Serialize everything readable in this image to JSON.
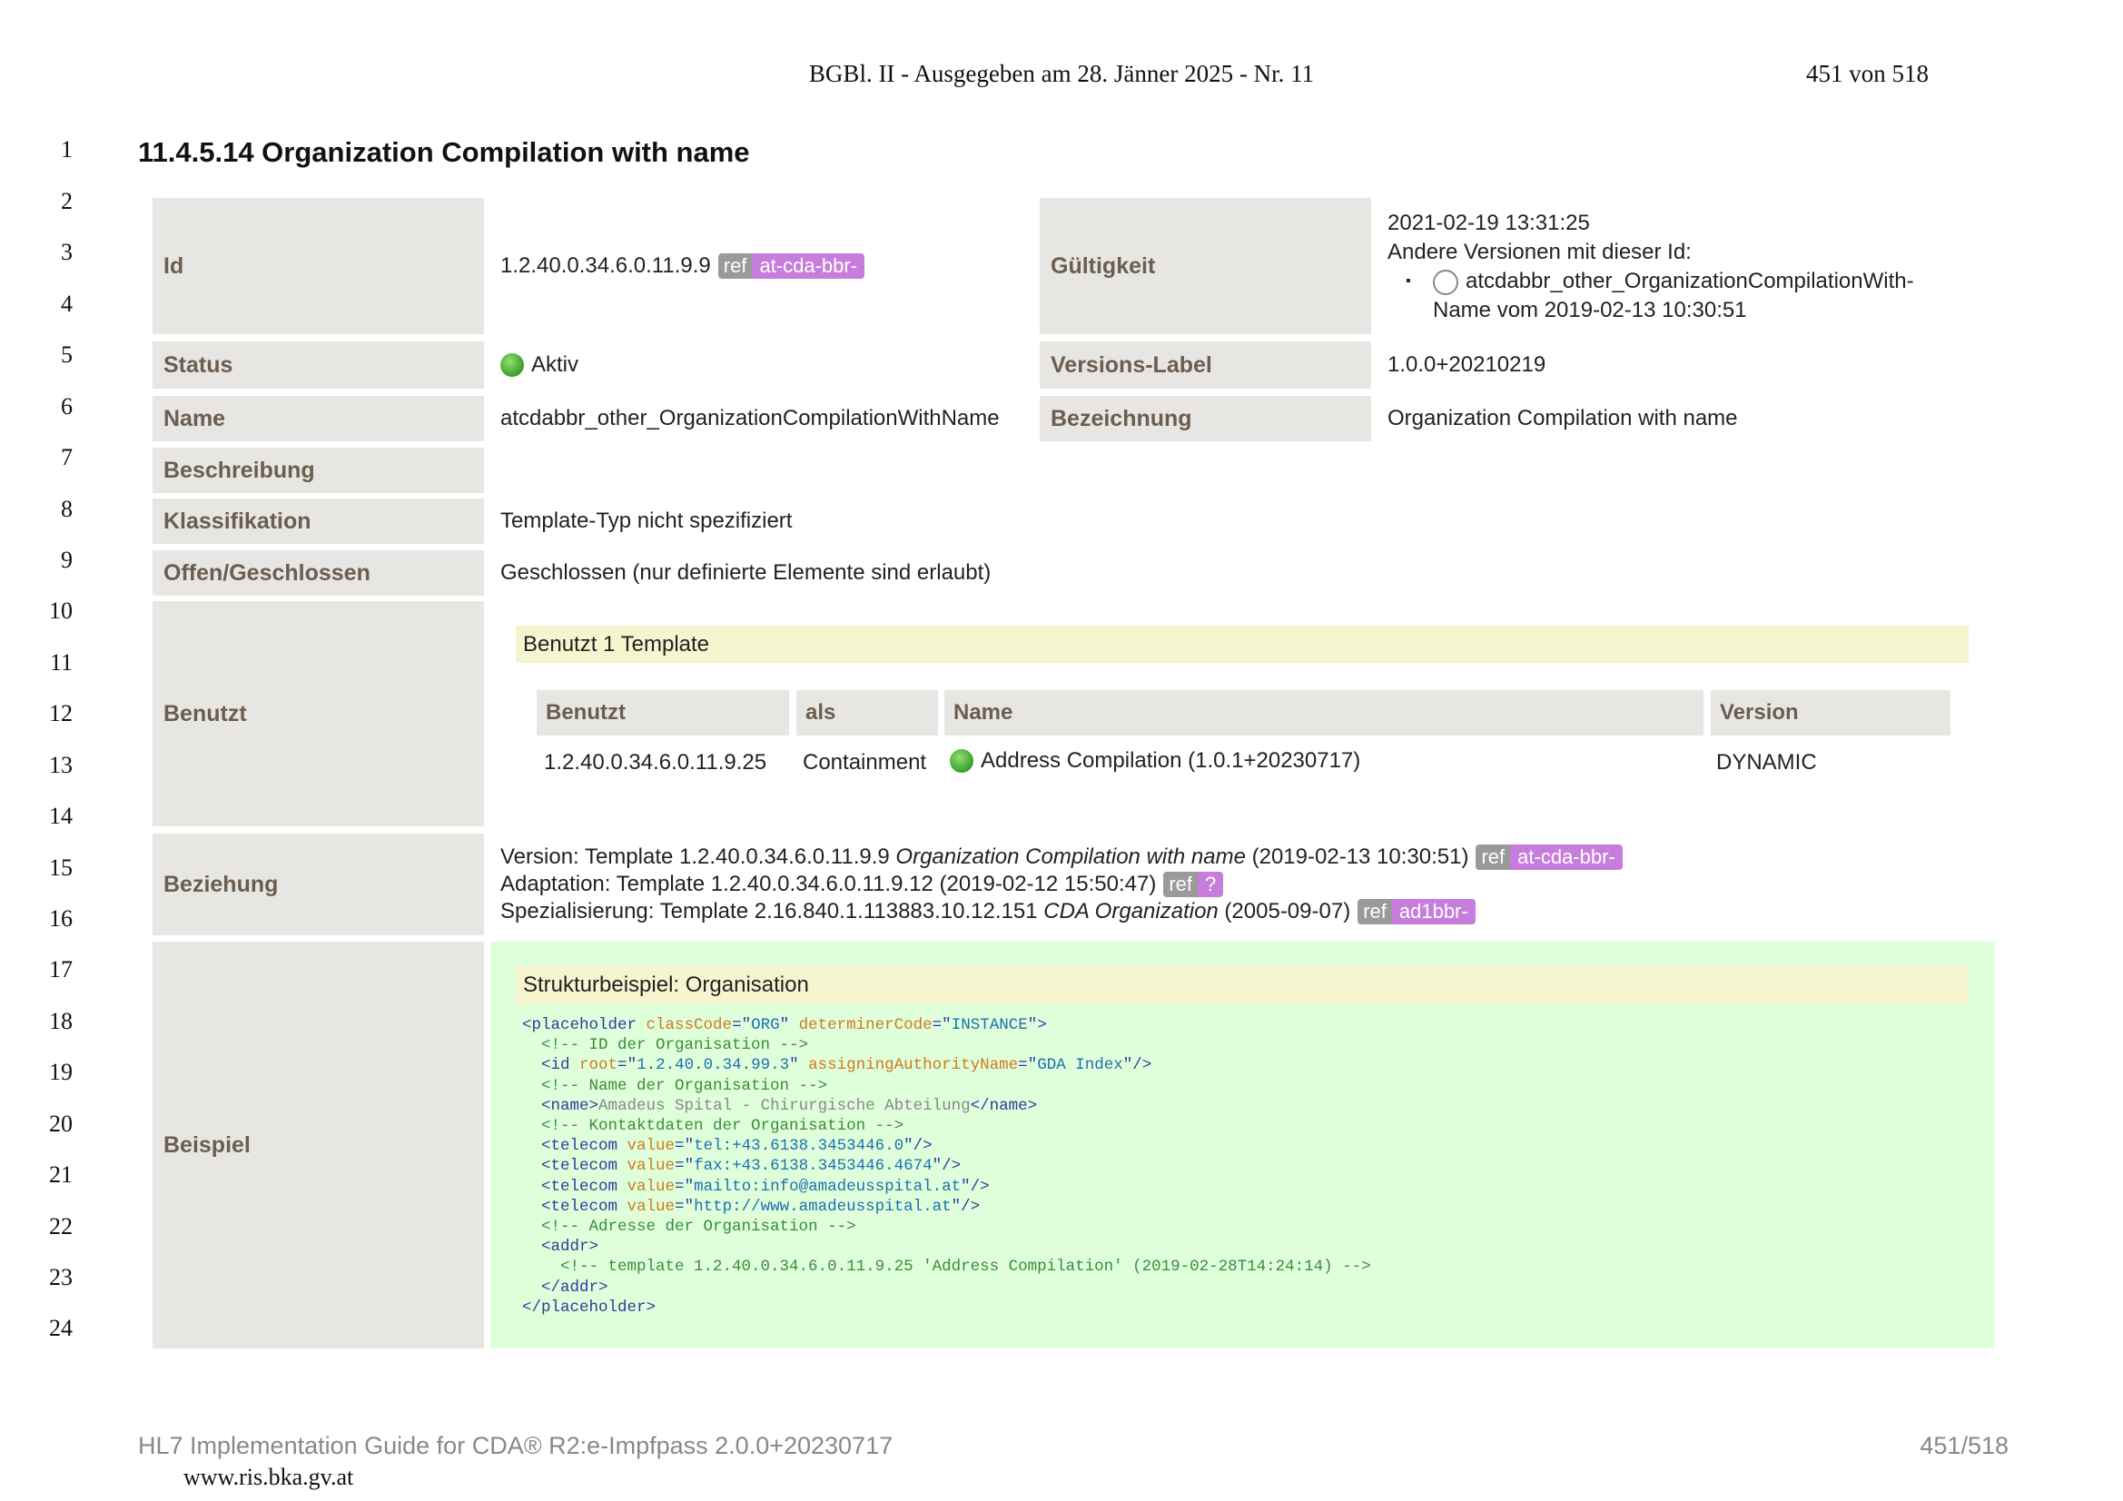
{
  "header": {
    "gazette": "BGBl. II - Ausgegeben am 28. Jänner 2025 - Nr. 11",
    "page": "451 von 518"
  },
  "line_numbers": [
    "1",
    "2",
    "3",
    "4",
    "5",
    "6",
    "7",
    "8",
    "9",
    "10",
    "11",
    "12",
    "13",
    "14",
    "15",
    "16",
    "17",
    "18",
    "19",
    "20",
    "21",
    "22",
    "23",
    "24"
  ],
  "section_title": "11.4.5.14 Organization Compilation with name",
  "table": {
    "id_label": "Id",
    "id_value": "1.2.40.0.34.6.0.11.9.9",
    "id_ref": {
      "tag": "ref",
      "prefix": "at-cda-bbr-"
    },
    "validity_label": "Gültigkeit",
    "validity_date": "2021-02-19 13:31:25",
    "validity_other_versions": "Andere Versionen mit dieser Id:",
    "validity_bullet": "▪",
    "validity_version_line1": "atcdabbr_other_OrganizationCompilationWith-",
    "validity_version_line2": "Name vom 2019-02-13 10:30:51",
    "status_label": "Status",
    "status_value": "Aktiv",
    "versions_label": "Versions-Label",
    "versions_value": "1.0.0+20210219",
    "name_label": "Name",
    "name_value": "atcdabbr_other_OrganizationCompilationWithName",
    "bezeichnung_label": "Bezeichnung",
    "bezeichnung_value": "Organization Compilation with name",
    "beschreibung_label": "Beschreibung",
    "klassifikation_label": "Klassifikation",
    "klassifikation_value": "Template-Typ nicht spezifiziert",
    "offen_label": "Offen/Geschlossen",
    "offen_value": "Geschlossen (nur definierte Elemente sind erlaubt)",
    "benutzt_label": "Benutzt",
    "benutzt_bar": "Benutzt 1 Template",
    "benutzt_headers": [
      "Benutzt",
      "als",
      "Name",
      "Version"
    ],
    "benutzt_row": {
      "id": "1.2.40.0.34.6.0.11.9.25",
      "als": "Containment",
      "name": "Address Compilation (1.0.1+20230717)",
      "version": "DYNAMIC"
    },
    "beziehung_label": "Beziehung",
    "beziehung": {
      "l1_pre": "Version: Template 1.2.40.0.34.6.0.11.9.9 ",
      "l1_italic": "Organization Compilation with name",
      "l1_post": " (2019-02-13 10:30:51)",
      "l1_ref": "at-cda-bbr-",
      "l2_text": "Adaptation: Template 1.2.40.0.34.6.0.11.9.12 (2019-02-12 15:50:47)",
      "l2_ref": "?",
      "l3_pre": "Spezialisierung: Template 2.16.840.1.113883.10.12.151 ",
      "l3_italic": "CDA Organization",
      "l3_post": " (2005-09-07)",
      "l3_ref": "ad1bbr-",
      "ref_tag": "ref"
    },
    "beispiel_label": "Beispiel",
    "beispiel_bar": "Strukturbeispiel: Organisation"
  },
  "code_lines": [
    "<placeholder classCode=\"ORG\" determinerCode=\"INSTANCE\">",
    "  <!-- ID der Organisation -->",
    "  <id root=\"1.2.40.0.34.99.3\" assigningAuthorityName=\"GDA Index\"/>",
    "  <!-- Name der Organisation -->",
    "  <name>Amadeus Spital - Chirurgische Abteilung</name>",
    "  <!-- Kontaktdaten der Organisation -->",
    "  <telecom value=\"tel:+43.6138.3453446.0\"/>",
    "  <telecom value=\"fax:+43.6138.3453446.4674\"/>",
    "  <telecom value=\"mailto:info@amadeusspital.at\"/>",
    "  <telecom value=\"http://www.amadeusspital.at\"/>",
    "  <!-- Adresse der Organisation -->",
    "  <addr>",
    "    <!-- template 1.2.40.0.34.6.0.11.9.25 'Address Compilation' (2019-02-28T14:24:14) -->",
    "  </addr>",
    "</placeholder>"
  ],
  "footer": {
    "guide": "HL7 Implementation Guide for CDA® R2:e-Impfpass 2.0.0+20230717",
    "page": "451/518",
    "url": "www.ris.bka.gv.at"
  },
  "colors": {
    "label_bg": "#e8e6e3",
    "label_text": "#6b5d4f",
    "ref_grey": "#9a9a9a",
    "ref_purple": "#c77ddc",
    "example_bg": "#dfffdb",
    "bar_bg": "#f5f5cf",
    "status_green": "#3b9e2a"
  }
}
